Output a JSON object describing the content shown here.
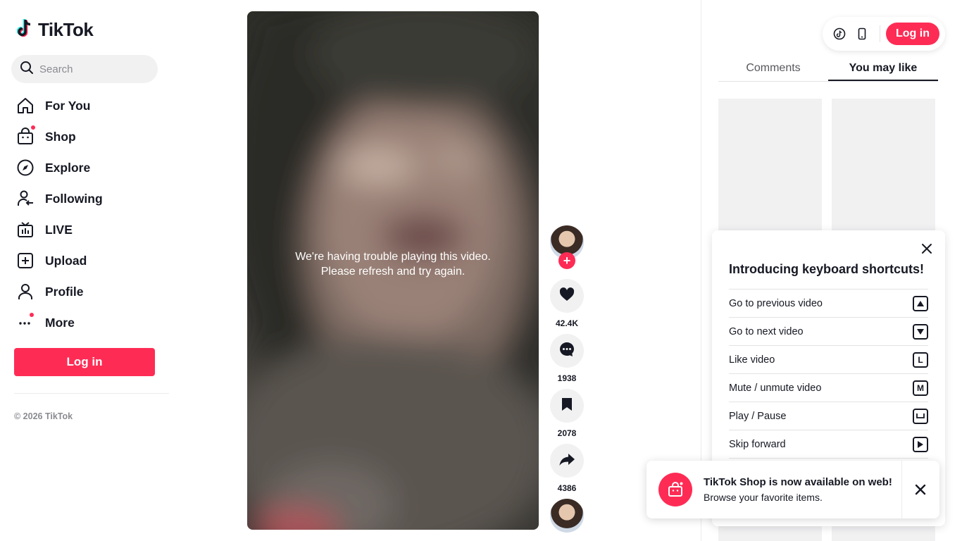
{
  "app": {
    "logo_text": "TikTok"
  },
  "search": {
    "placeholder": "Search"
  },
  "nav": {
    "items": [
      {
        "label": "For You",
        "icon": "home-icon"
      },
      {
        "label": "Shop",
        "icon": "shop-bag-icon"
      },
      {
        "label": "Explore",
        "icon": "compass-icon"
      },
      {
        "label": "Following",
        "icon": "following-user-icon"
      },
      {
        "label": "LIVE",
        "icon": "live-tv-icon"
      },
      {
        "label": "Upload",
        "icon": "upload-plus-icon"
      },
      {
        "label": "Profile",
        "icon": "profile-user-icon"
      },
      {
        "label": "More",
        "icon": "more-dots-icon"
      }
    ]
  },
  "sidebar": {
    "login_label": "Log in",
    "copyright": "© 2026 TikTok"
  },
  "video": {
    "error_line1": "We're having trouble playing this video.",
    "error_line2": "Please refresh and try again."
  },
  "actions": {
    "likes": "42.4K",
    "comments": "1938",
    "bookmarks": "2078",
    "shares": "4386",
    "follow_symbol": "+"
  },
  "header": {
    "login_label": "Log in"
  },
  "tabs": [
    {
      "label": "Comments",
      "active": false
    },
    {
      "label": "You may like",
      "active": true
    }
  ],
  "shortcuts": {
    "title": "Introducing keyboard shortcuts!",
    "items": [
      {
        "label": "Go to previous video",
        "key": "up-arrow"
      },
      {
        "label": "Go to next video",
        "key": "down-arrow"
      },
      {
        "label": "Like video",
        "key": "L"
      },
      {
        "label": "Mute / unmute video",
        "key": "M"
      },
      {
        "label": "Play / Pause",
        "key": "space"
      },
      {
        "label": "Skip forward",
        "key": "right-arrow"
      }
    ]
  },
  "toast": {
    "title": "TikTok Shop is now available on web!",
    "subtitle": "Browse your favorite items."
  },
  "colors": {
    "brand": "#fe2c55",
    "text": "#161823",
    "muted": "#8a8b91",
    "surface": "#f1f1f2"
  }
}
